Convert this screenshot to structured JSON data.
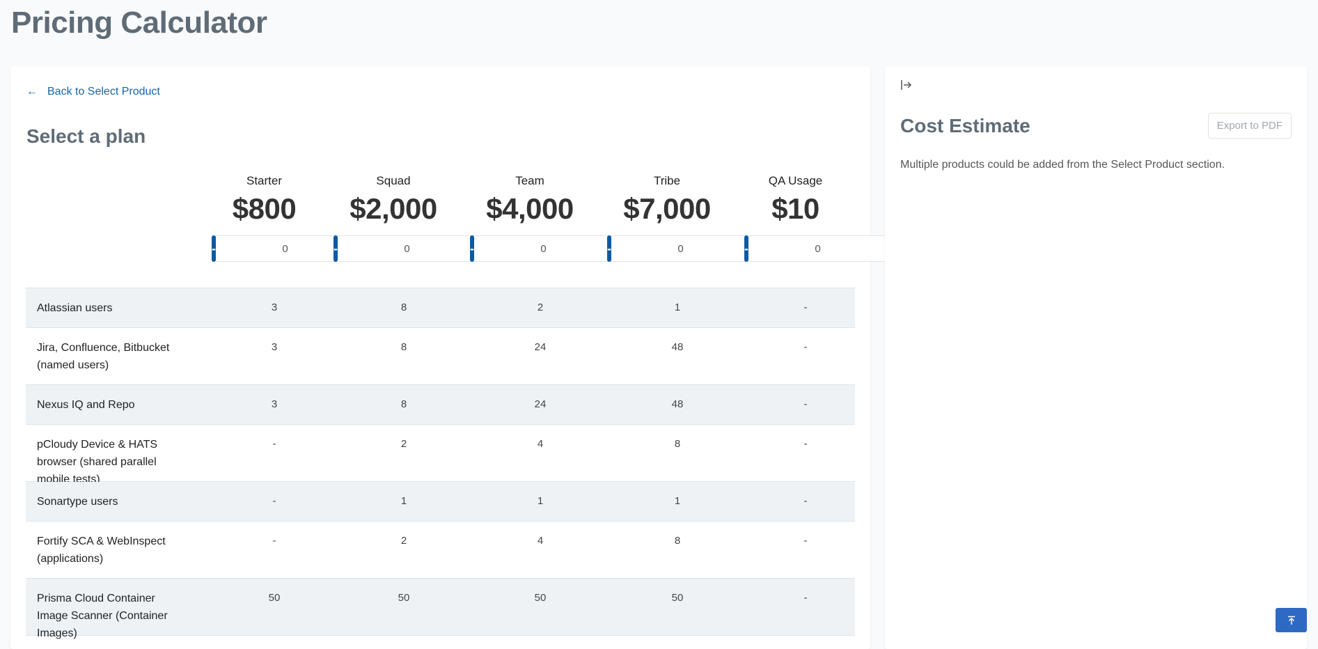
{
  "page": {
    "title": "Pricing Calculator"
  },
  "main": {
    "back_label": "Back to Select Product",
    "section_title": "Select a plan",
    "plans": [
      {
        "name": "Starter",
        "price": "$800",
        "qty": "0"
      },
      {
        "name": "Squad",
        "price": "$2,000",
        "qty": "0"
      },
      {
        "name": "Team",
        "price": "$4,000",
        "qty": "0"
      },
      {
        "name": "Tribe",
        "price": "$7,000",
        "qty": "0"
      },
      {
        "name": "QA Usage",
        "price": "$10",
        "qty": "0"
      }
    ],
    "stepper": {
      "minus": "-",
      "plus": "+"
    },
    "rows": [
      {
        "label": "Atlassian users",
        "values": [
          "3",
          "8",
          "2",
          "1",
          "-"
        ]
      },
      {
        "label": "Jira, Confluence, Bitbucket (named users)",
        "values": [
          "3",
          "8",
          "24",
          "48",
          "-"
        ]
      },
      {
        "label": "Nexus IQ and Repo",
        "values": [
          "3",
          "8",
          "24",
          "48",
          "-"
        ]
      },
      {
        "label": "pCloudy Device & HATS browser (shared parallel mobile tests)",
        "values": [
          "-",
          "2",
          "4",
          "8",
          "-"
        ]
      },
      {
        "label": "Sonartype users",
        "values": [
          "-",
          "1",
          "1",
          "1",
          "-"
        ]
      },
      {
        "label": "Fortify SCA & WebInspect (applications)",
        "values": [
          "-",
          "2",
          "4",
          "8",
          "-"
        ]
      },
      {
        "label": "Prisma Cloud Container Image Scanner (Container Images)",
        "values": [
          "50",
          "50",
          "50",
          "50",
          "-"
        ]
      }
    ]
  },
  "side": {
    "collapse_icon": "collapse-right-icon",
    "cost_title": "Cost Estimate",
    "export_label": "Export to PDF",
    "note": "Multiple products could be added from the Select Product section."
  },
  "scroll_top_icon": "arrow-up-to-top-icon",
  "colors": {
    "primary": "#0a5aa4",
    "title": "#5f6c77",
    "row_shade": "#eef2f5",
    "scroll_btn": "#2e6ac4"
  }
}
